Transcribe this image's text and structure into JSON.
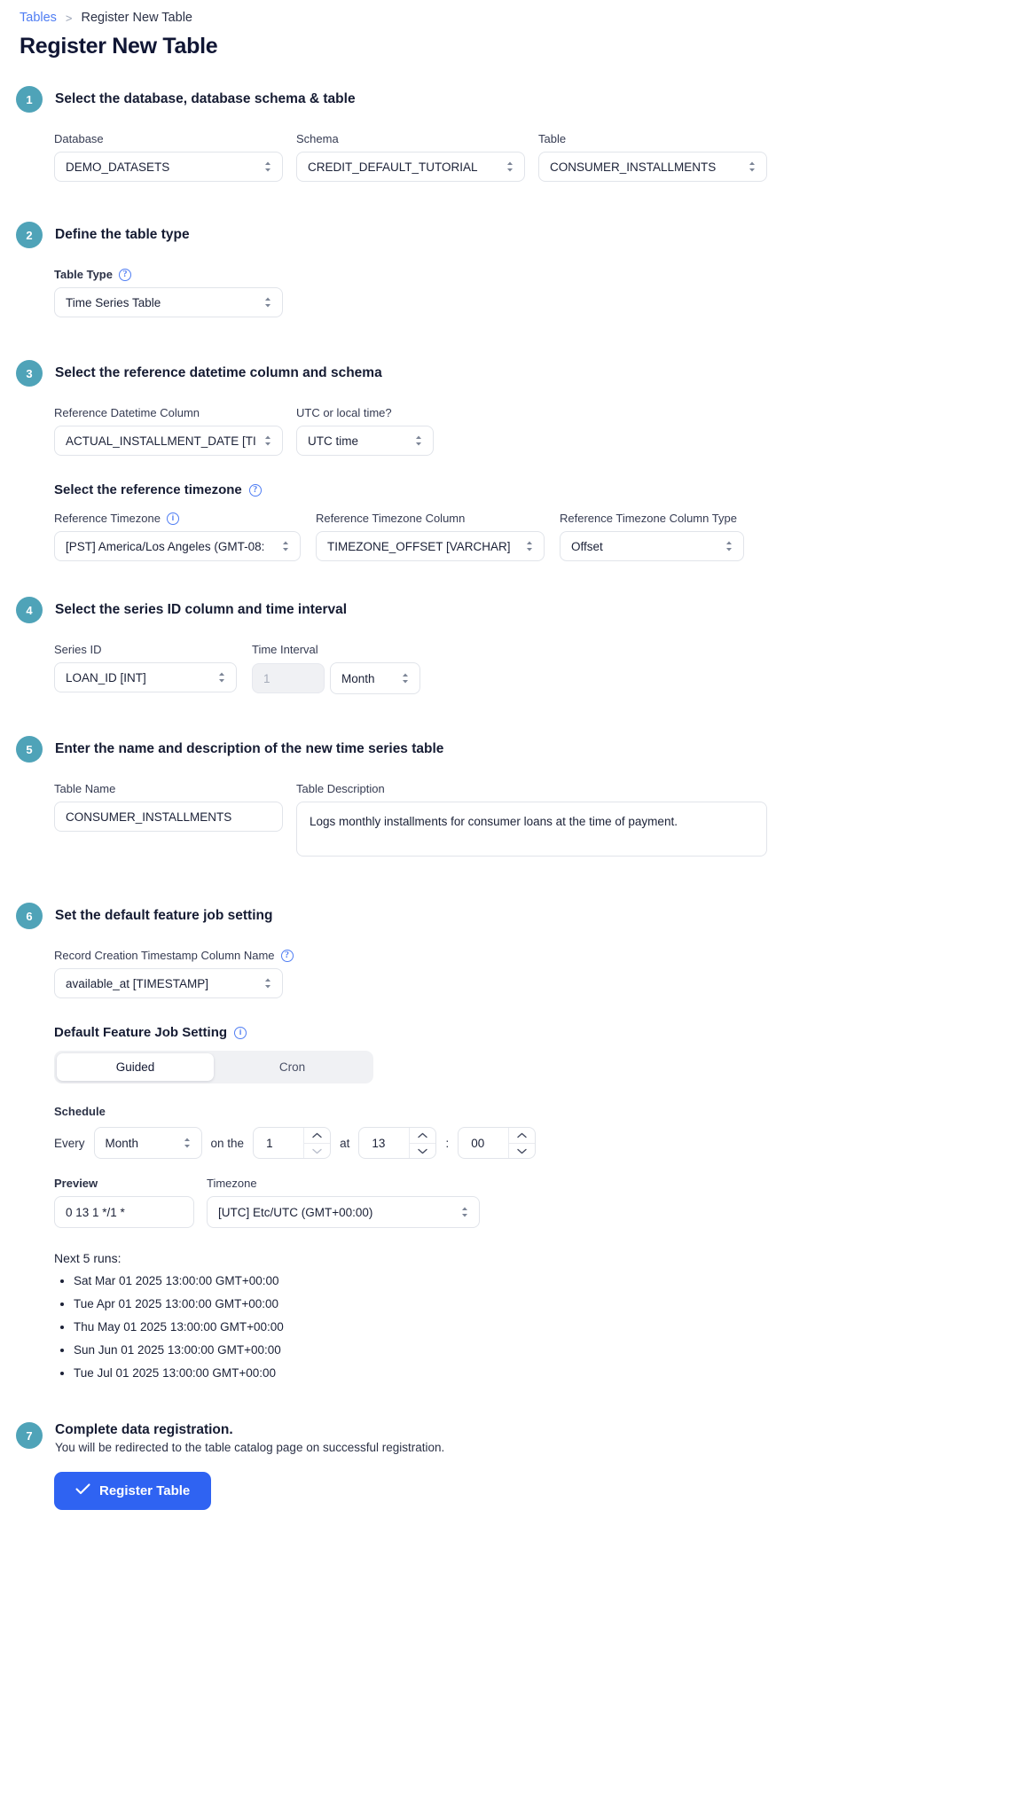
{
  "breadcrumb": {
    "parent": "Tables",
    "separator": ">",
    "current": "Register New Table"
  },
  "page_title": "Register New Table",
  "steps": [
    {
      "number": "1",
      "title": "Select the database, database schema & table",
      "fields": {
        "database_label": "Database",
        "database_value": "DEMO_DATASETS",
        "schema_label": "Schema",
        "schema_value": "CREDIT_DEFAULT_TUTORIAL",
        "table_label": "Table",
        "table_value": "CONSUMER_INSTALLMENTS"
      }
    },
    {
      "number": "2",
      "title": "Define the table type",
      "fields": {
        "table_type_label": "Table Type",
        "table_type_value": "Time Series Table"
      }
    },
    {
      "number": "3",
      "title": "Select the reference datetime column and schema",
      "fields": {
        "ref_datetime_label": "Reference Datetime Column",
        "ref_datetime_value": "ACTUAL_INSTALLMENT_DATE  [TI",
        "utc_label": "UTC or local time?",
        "utc_value": "UTC time",
        "timezone_subhead": "Select the reference timezone",
        "ref_timezone_label": "Reference Timezone",
        "ref_timezone_value": "[PST] America/Los Angeles (GMT-08:",
        "ref_timezone_col_label": "Reference Timezone Column",
        "ref_timezone_col_value": "TIMEZONE_OFFSET [VARCHAR]",
        "ref_timezone_coltype_label": "Reference Timezone Column Type",
        "ref_timezone_coltype_value": "Offset"
      }
    },
    {
      "number": "4",
      "title": "Select the series ID column and time interval",
      "fields": {
        "series_id_label": "Series ID",
        "series_id_value": "LOAN_ID [INT]",
        "time_interval_label": "Time Interval",
        "time_interval_value": "1",
        "time_interval_unit": "Month"
      }
    },
    {
      "number": "5",
      "title": "Enter the name and description of the new time series table",
      "fields": {
        "table_name_label": "Table Name",
        "table_name_value": "CONSUMER_INSTALLMENTS",
        "table_desc_label": "Table Description",
        "table_desc_value": "Logs monthly installments for consumer loans at the time of payment."
      }
    },
    {
      "number": "6",
      "title": "Set the default feature job setting",
      "fields": {
        "record_ts_label": "Record Creation Timestamp Column Name",
        "record_ts_value": "available_at [TIMESTAMP]",
        "djfs_subhead": "Default Feature Job Setting",
        "toggle_guided": "Guided",
        "toggle_cron": "Cron",
        "schedule_label": "Schedule",
        "every_word": "Every",
        "every_unit": "Month",
        "onthe_word": "on the",
        "day_value": "1",
        "at_word": "at",
        "hour_value": "13",
        "colon": ":",
        "minute_value": "00",
        "preview_label": "Preview",
        "preview_value": "0 13 1 */1 *",
        "timezone_label": "Timezone",
        "timezone_value": "[UTC] Etc/UTC (GMT+00:00)",
        "next_runs_title": "Next 5 runs:",
        "next_runs": [
          "Sat Mar 01 2025 13:00:00 GMT+00:00",
          "Tue Apr 01 2025 13:00:00 GMT+00:00",
          "Thu May 01 2025 13:00:00 GMT+00:00",
          "Sun Jun 01 2025 13:00:00 GMT+00:00",
          "Tue Jul 01 2025 13:00:00 GMT+00:00"
        ]
      }
    },
    {
      "number": "7",
      "title": "Complete data registration.",
      "fields": {
        "subtitle": "You will be redirected to the table catalog page on successful registration.",
        "register_button": "Register Table"
      }
    }
  ],
  "colors": {
    "step_badge": "#4fa3b8",
    "primary_button": "#2f63f2",
    "link": "#4f7df3",
    "help_icon": "#4f7df3"
  }
}
